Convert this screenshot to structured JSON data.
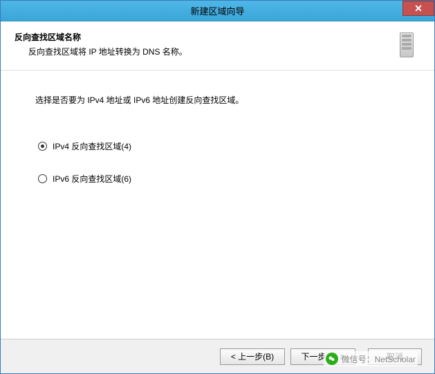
{
  "window": {
    "title": "新建区域向导"
  },
  "header": {
    "title": "反向查找区域名称",
    "subtitle": "反向查找区域将 IP 地址转换为 DNS 名称。"
  },
  "content": {
    "instruction": "选择是否要为 IPv4 地址或 IPv6 地址创建反向查找区域。",
    "options": {
      "ipv4": "IPv4 反向查找区域(4)",
      "ipv6": "IPv6 反向查找区域(6)"
    }
  },
  "buttons": {
    "back": "< 上一步(B)",
    "next": "下一步(N) >",
    "cancel": "取消"
  },
  "overlay": {
    "text": "微信号：NetScholar"
  }
}
